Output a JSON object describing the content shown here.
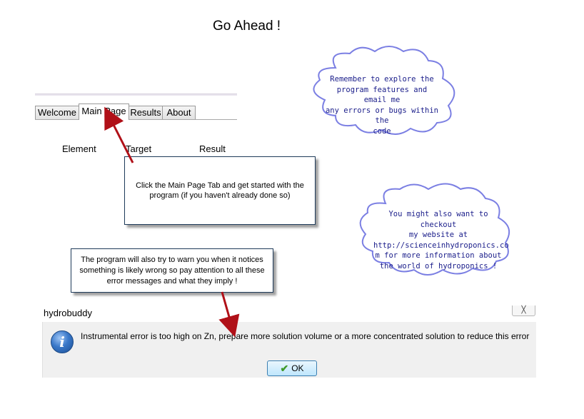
{
  "title": "Go Ahead !",
  "tabs": [
    {
      "label": "Welcome"
    },
    {
      "label": "Main Page"
    },
    {
      "label": "Results"
    },
    {
      "label": "About"
    }
  ],
  "table_headers": [
    "Element",
    "Target",
    "Result"
  ],
  "callouts": {
    "main_page_tab": "Click the Main Page Tab and get started with the program (if you haven't already done so)",
    "warnings": "The program will also try to warn you when it notices something is likely wrong so pay attention to all these error messages and what they imply !"
  },
  "clouds": {
    "explore": [
      "Remember to explore the",
      "program features and email me",
      "any errors or bugs within the",
      "code"
    ],
    "website": [
      "You might also want to checkout",
      "my website at",
      "http://scienceinhydroponics.co",
      "m for more information about",
      "the world of hydroponics !"
    ]
  },
  "dialog": {
    "title": "hydrobuddy",
    "close_glyph": "╳",
    "message": "Instrumental error is too high on Zn, prepare more solution volume or a more concentrated solution to reduce this error",
    "ok_label": "OK",
    "icon": "info-icon",
    "ok_icon": "checkmark-icon"
  },
  "colors": {
    "cloud_border": "#7b7fe3",
    "cloud_text": "#1a1d8a",
    "arrow": "#b01018",
    "callout_border": "#1f3b5a"
  }
}
